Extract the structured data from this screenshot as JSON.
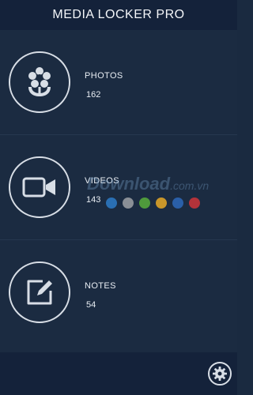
{
  "header": {
    "title": "MEDIA LOCKER PRO"
  },
  "items": [
    {
      "label": "PHOTOS",
      "count": "162",
      "icon": "flower-icon"
    },
    {
      "label": "VIDEOS",
      "count": "143",
      "icon": "video-camera-icon"
    },
    {
      "label": "NOTES",
      "count": "54",
      "icon": "edit-note-icon"
    }
  ],
  "watermark": {
    "text": "Download",
    "suffix": ".com.vn"
  },
  "watermark_dots": [
    "#2a6fb3",
    "#8a8f96",
    "#4f9a3c",
    "#c9962a",
    "#2a5fa8",
    "#b3333a"
  ],
  "footer": {
    "icon": "gear-icon"
  },
  "colors": {
    "background": "#1b2b41",
    "bar": "#14223a",
    "stroke": "#d8dee6"
  }
}
